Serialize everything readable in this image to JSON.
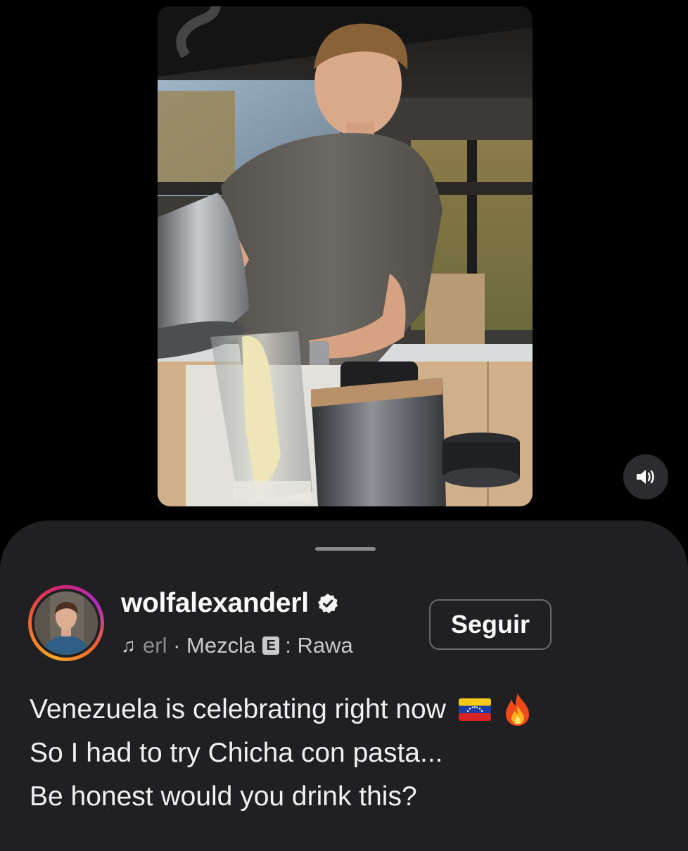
{
  "sound_button": {
    "icon": "speaker-icon"
  },
  "post": {
    "username": "wolfalexanderl",
    "verified": true,
    "music": {
      "icon": "music-note-icon",
      "artist_fragment": "erl",
      "separator": "·",
      "label": "Mezcla",
      "explicit_badge": "E",
      "track_fragment": ": Rawa"
    },
    "follow_label": "Seguir",
    "caption": {
      "line1": "Venezuela is celebrating right now",
      "line1_emojis": [
        "venezuela-flag-icon",
        "fire-icon"
      ],
      "line2": "So I had to try Chicha con pasta...",
      "line3": "Be honest would you drink this?"
    }
  },
  "colors": {
    "background": "#000000",
    "sheet": "#202023",
    "text": "#f5f5f5",
    "muted": "#c9c9cc",
    "button_border": "#6a6a6e"
  }
}
